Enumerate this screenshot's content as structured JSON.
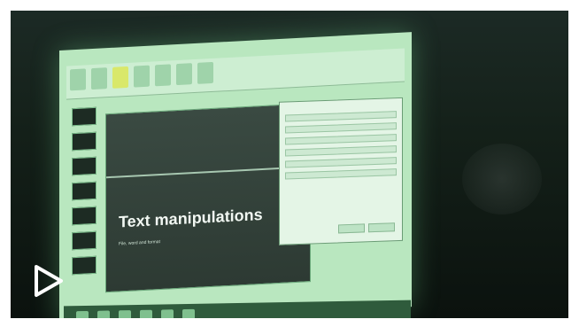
{
  "image": {
    "slide_title": "Text manipulations",
    "slide_subtitle": "File, word and format",
    "colors": {
      "room": "#142019",
      "screen_glow": "#b9e7bf",
      "slide_background": "#2d3a33",
      "play_icon": "#ffffff"
    },
    "icons": [
      "play-icon"
    ]
  }
}
